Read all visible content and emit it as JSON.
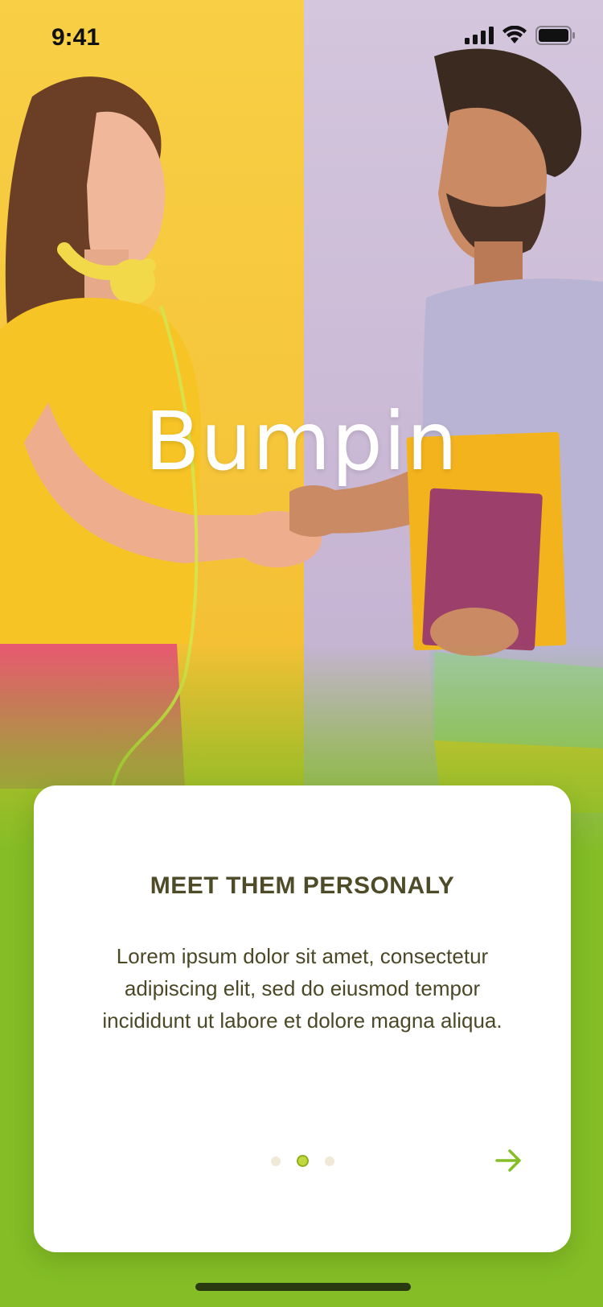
{
  "status_bar": {
    "time": "9:41"
  },
  "hero": {
    "logo_text": "Bumpin"
  },
  "card": {
    "title": "MEET THEM PERSONALY",
    "body": "Lorem ipsum dolor sit amet, consectetur adipiscing elit, sed do eiusmod tempor incididunt ut labore et dolore magna aliqua.",
    "pagination": {
      "total": 3,
      "active_index": 1
    },
    "next_icon": "arrow-right-icon"
  },
  "colors": {
    "brand_green": "#84bd26",
    "title_text": "#4d4b28",
    "active_dot": "#c2d83f",
    "arrow": "#84bd26"
  }
}
